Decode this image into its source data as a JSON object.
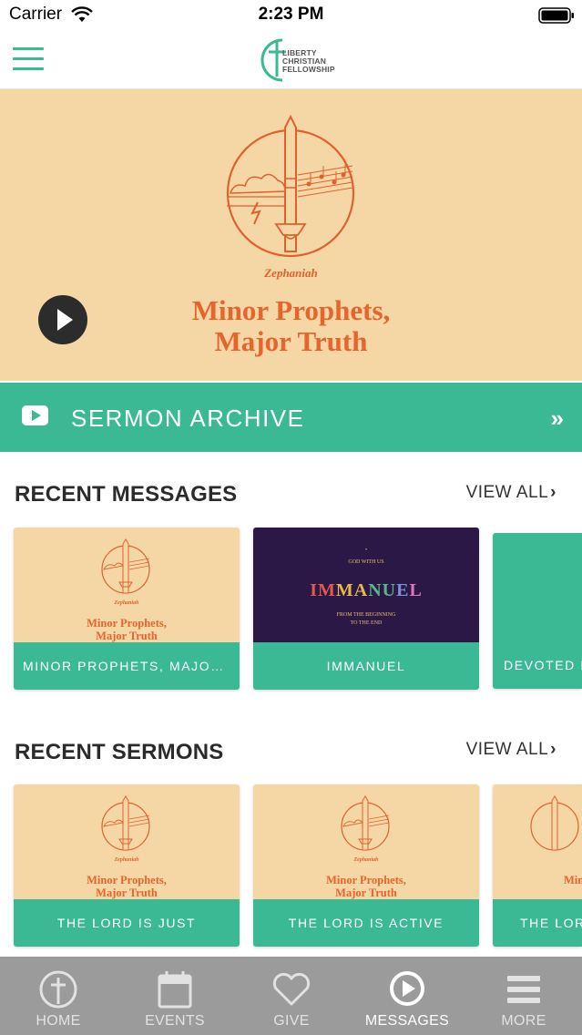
{
  "status_bar": {
    "carrier": "Carrier",
    "time": "2:23 PM"
  },
  "header": {
    "logo_line1": "LIBERTY",
    "logo_line2": "CHRISTIAN",
    "logo_line3": "FELLOWSHIP",
    "icons": [
      "menu-icon",
      "cross-logo"
    ]
  },
  "hero": {
    "subtitle": "Zephaniah",
    "title_line1": "Minor Prophets,",
    "title_line2": "Major Truth",
    "play_icon": "play-icon"
  },
  "archive": {
    "label": "SERMON ARCHIVE",
    "icon": "youtube-play-icon",
    "chevron": "»"
  },
  "recent_messages": {
    "title": "RECENT MESSAGES",
    "view_all": "VIEW ALL",
    "cards": [
      {
        "label": "MINOR PROPHETS, MAJOR T...",
        "art_subtitle": "Zephaniah",
        "art_title_line1": "Minor Prophets,",
        "art_title_line2": "Major Truth"
      },
      {
        "label": "IMMANUEL",
        "art_top": "GOD WITH US",
        "art_title": "IMMANUEL",
        "art_line1": "FROM THE BEGINNING",
        "art_line2": "TO THE END"
      },
      {
        "label": "DEVOTED F"
      }
    ]
  },
  "recent_sermons": {
    "title": "RECENT SERMONS",
    "view_all": "VIEW ALL",
    "cards": [
      {
        "label": "THE LORD IS JUST",
        "art_subtitle": "Zephaniah",
        "art_title_line1": "Minor Prophets,",
        "art_title_line2": "Major Truth"
      },
      {
        "label": "THE LORD IS ACTIVE",
        "art_subtitle": "Zephaniah",
        "art_title_line1": "Minor Prophets,",
        "art_title_line2": "Major Truth"
      },
      {
        "label": "THE LOR",
        "art_title_line1": "Min"
      }
    ]
  },
  "tabs": [
    {
      "label": "HOME",
      "icon": "cross-circle-icon",
      "active": false
    },
    {
      "label": "EVENTS",
      "icon": "calendar-icon",
      "active": false
    },
    {
      "label": "GIVE",
      "icon": "heart-icon",
      "active": false
    },
    {
      "label": "MESSAGES",
      "icon": "play-circle-icon",
      "active": true
    },
    {
      "label": "MORE",
      "icon": "menu-icon",
      "active": false
    }
  ],
  "colors": {
    "accent": "#3bb894",
    "hero_bg": "#f5d7a6",
    "hero_text": "#e8642d",
    "tab_bar": "#9b9b9b",
    "immanuel_bg": "#2b1846"
  }
}
